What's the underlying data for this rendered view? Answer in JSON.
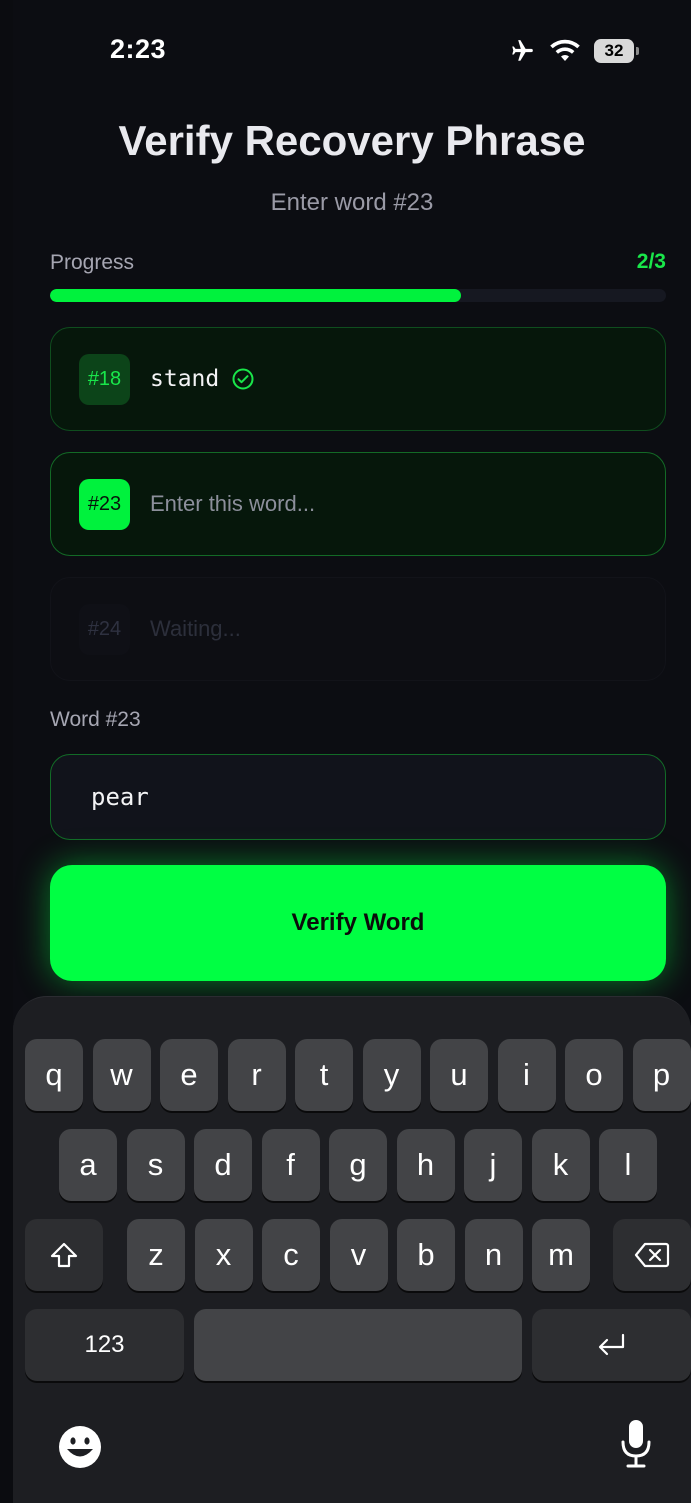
{
  "status_bar": {
    "time": "2:23",
    "battery": "32",
    "icons": [
      "airplane-icon",
      "wifi-icon",
      "battery-icon"
    ]
  },
  "header": {
    "title": "Verify Recovery Phrase",
    "subtitle": "Enter word #23"
  },
  "progress": {
    "label": "Progress",
    "count": "2/3",
    "fraction": 0.667,
    "fill_color": "#00f23d"
  },
  "words": [
    {
      "number": "#18",
      "text": "stand",
      "state": "verified"
    },
    {
      "number": "#23",
      "text": "Enter this word...",
      "state": "active"
    },
    {
      "number": "#24",
      "text": "Waiting...",
      "state": "waiting"
    }
  ],
  "input": {
    "label": "Word #23",
    "value": "pear"
  },
  "verify_button": {
    "label": "Verify Word",
    "color": "#00ff43"
  },
  "keyboard": {
    "row1": [
      "q",
      "w",
      "e",
      "r",
      "t",
      "y",
      "u",
      "i",
      "o",
      "p"
    ],
    "row2": [
      "a",
      "s",
      "d",
      "f",
      "g",
      "h",
      "j",
      "k",
      "l"
    ],
    "row3": [
      "z",
      "x",
      "c",
      "v",
      "b",
      "n",
      "m"
    ],
    "numbers_key": "123",
    "icons": [
      "shift-icon",
      "backspace-icon",
      "return-icon",
      "emoji-icon",
      "microphone-icon"
    ]
  }
}
